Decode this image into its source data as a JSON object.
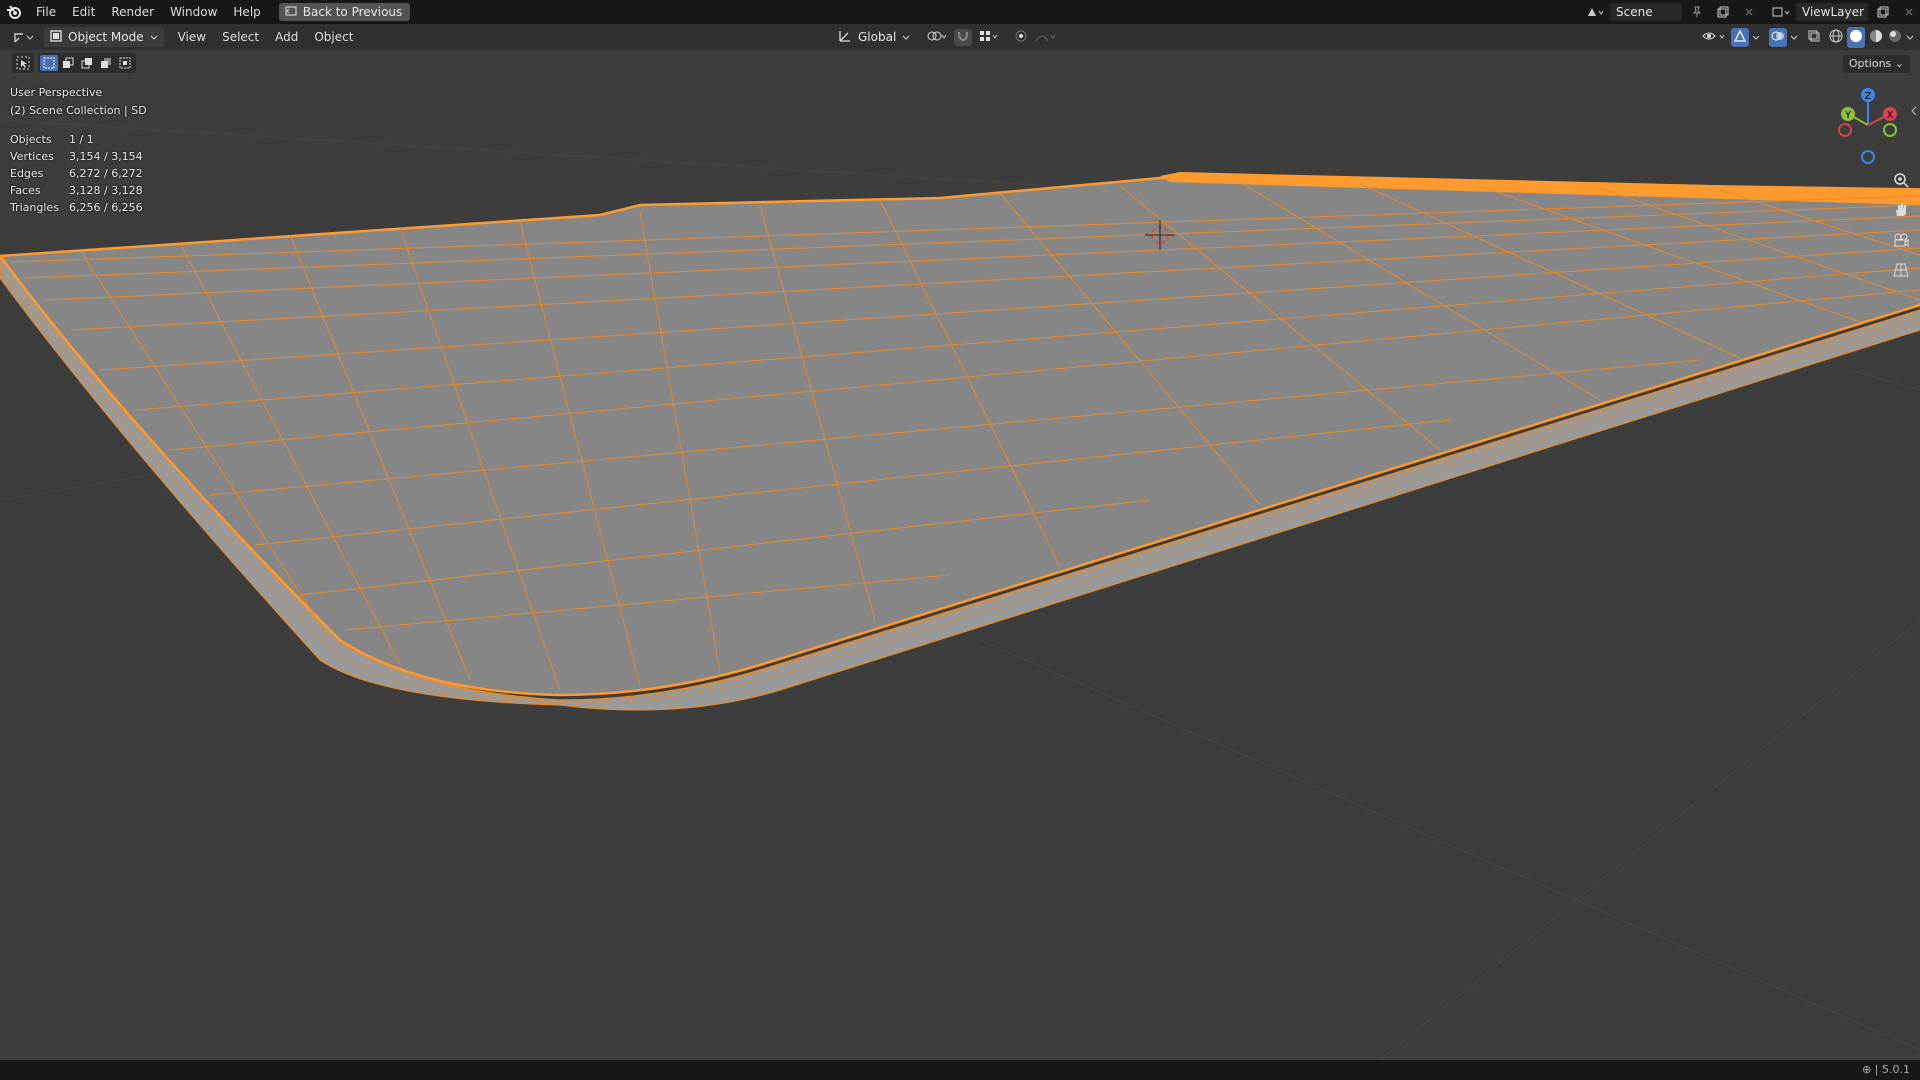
{
  "menu": {
    "items": [
      "File",
      "Edit",
      "Render",
      "Window",
      "Help"
    ],
    "back_button": "Back to Previous"
  },
  "topright": {
    "scene_name": "Scene",
    "view_layer": "ViewLayer"
  },
  "header": {
    "mode": "Object Mode",
    "menus": [
      "View",
      "Select",
      "Add",
      "Object"
    ],
    "transform_orientation": "Global"
  },
  "viewport": {
    "perspective_label": "User Perspective",
    "collection_label": "(2) Scene Collection | SD",
    "options_label": "Options",
    "stats": [
      {
        "label": "Objects",
        "value": "1 / 1"
      },
      {
        "label": "Vertices",
        "value": "3,154 / 3,154"
      },
      {
        "label": "Edges",
        "value": "6,272 / 6,272"
      },
      {
        "label": "Faces",
        "value": "3,128 / 3,128"
      },
      {
        "label": "Triangles",
        "value": "6,256 / 6,256"
      }
    ],
    "gizmo_axes": {
      "x": "X",
      "y": "Y",
      "z": "Z"
    }
  },
  "status": {
    "version": "5.0.1"
  },
  "colors": {
    "selection_outline": "#ff9a2e",
    "wire": "#e8892a",
    "surface": "#8a8a8a",
    "axis_x": "#d9434f",
    "axis_y": "#8bbf3c",
    "axis_z": "#3b86e8"
  },
  "icons": [
    "blender-logo",
    "back-icon",
    "editor-type-icon",
    "object-mode-icon",
    "transform-icon",
    "snap-icon",
    "proportional-icon",
    "visibility-icon",
    "gizmo-icon",
    "overlay-icon",
    "xray-icon",
    "wireframe-shading-icon",
    "solid-shading-icon",
    "material-shading-icon",
    "rendered-shading-icon",
    "zoom-icon",
    "hand-icon",
    "camera-icon",
    "grid-icon",
    "pin-icon",
    "copy-icon",
    "close-icon"
  ]
}
